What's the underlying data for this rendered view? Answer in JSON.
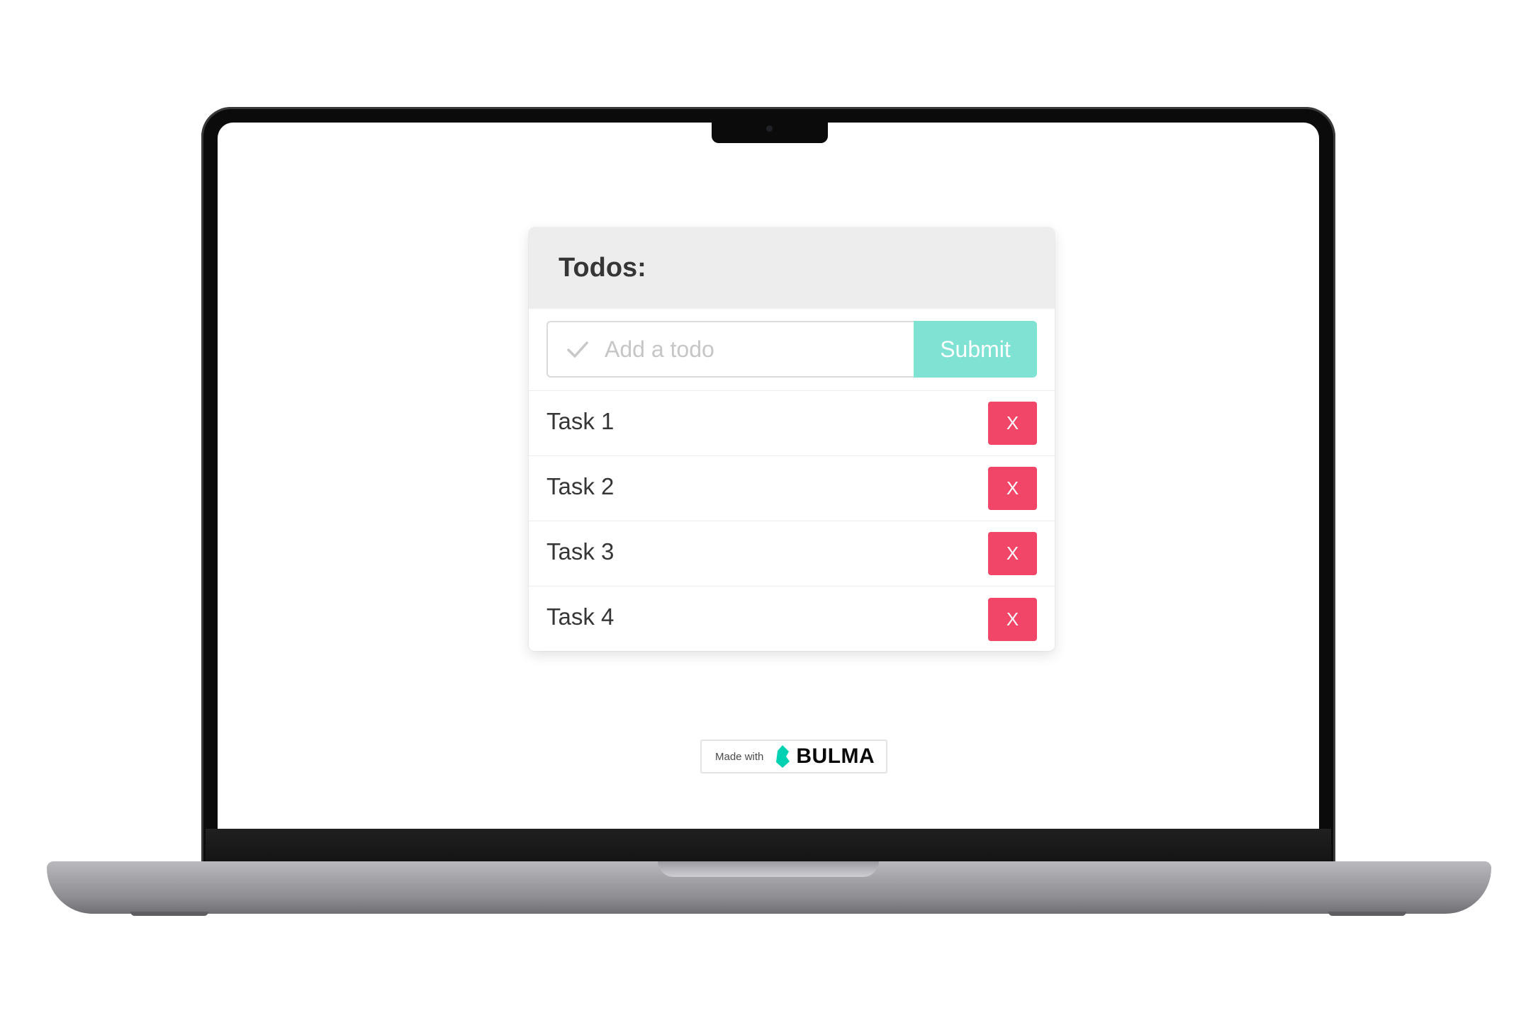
{
  "app": {
    "card_title": "Todos:",
    "input_placeholder": "Add a todo",
    "input_value": "",
    "submit_label": "Submit",
    "tasks": [
      {
        "label": "Task 1",
        "delete_label": "X"
      },
      {
        "label": "Task 2",
        "delete_label": "X"
      },
      {
        "label": "Task 3",
        "delete_label": "X"
      },
      {
        "label": "Task 4",
        "delete_label": "X"
      }
    ]
  },
  "badge": {
    "made_with": "Made with",
    "brand": "BULMA"
  },
  "icons": {
    "input_icon": "check-icon",
    "badge_icon": "bulma-logo-icon"
  },
  "colors": {
    "submit": "#7fe2d3",
    "delete": "#f14668",
    "header_bg": "#ededed",
    "bulma": "#00d1b2"
  }
}
